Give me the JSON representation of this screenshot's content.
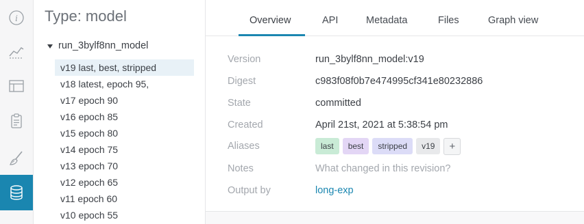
{
  "rail": {
    "items": [
      {
        "icon": "info-icon"
      },
      {
        "icon": "chart-icon"
      },
      {
        "icon": "table-icon"
      },
      {
        "icon": "clipboard-icon"
      },
      {
        "icon": "brush-icon"
      },
      {
        "icon": "database-icon",
        "active": true
      }
    ],
    "active_color": "#1a86b0"
  },
  "list": {
    "type_title": "Type: model",
    "collection": "run_3bylf8nn_model",
    "versions": [
      "v19 last, best, stripped",
      "v18 latest, epoch 95,",
      "v17 epoch 90",
      "v16 epoch 85",
      "v15 epoch 80",
      "v14 epoch 75",
      "v13 epoch 70",
      "v12 epoch 65",
      "v11 epoch 60",
      "v10 epoch 55"
    ],
    "selected_index": 0
  },
  "tabs": {
    "overview": "Overview",
    "api": "API",
    "metadata": "Metadata",
    "files": "Files",
    "graph_view": "Graph view",
    "active": "overview"
  },
  "details": {
    "version_label": "Version",
    "version_value": "run_3bylf8nn_model:v19",
    "digest_label": "Digest",
    "digest_value": "c983f08f0b7e474995cf341e80232886",
    "state_label": "State",
    "state_value": "committed",
    "created_label": "Created",
    "created_value": "April 21st, 2021 at 5:38:54 pm",
    "aliases_label": "Aliases",
    "aliases": [
      {
        "text": "last",
        "color": "#c9ebd6"
      },
      {
        "text": "best",
        "color": "#e3d6f5"
      },
      {
        "text": "stripped",
        "color": "#dcdcf7"
      },
      {
        "text": "v19",
        "color": "#e8e9eb"
      }
    ],
    "add_alias": "+",
    "notes_label": "Notes",
    "notes_placeholder": "What changed in this revision?",
    "output_label": "Output by",
    "output_value": "long-exp"
  }
}
